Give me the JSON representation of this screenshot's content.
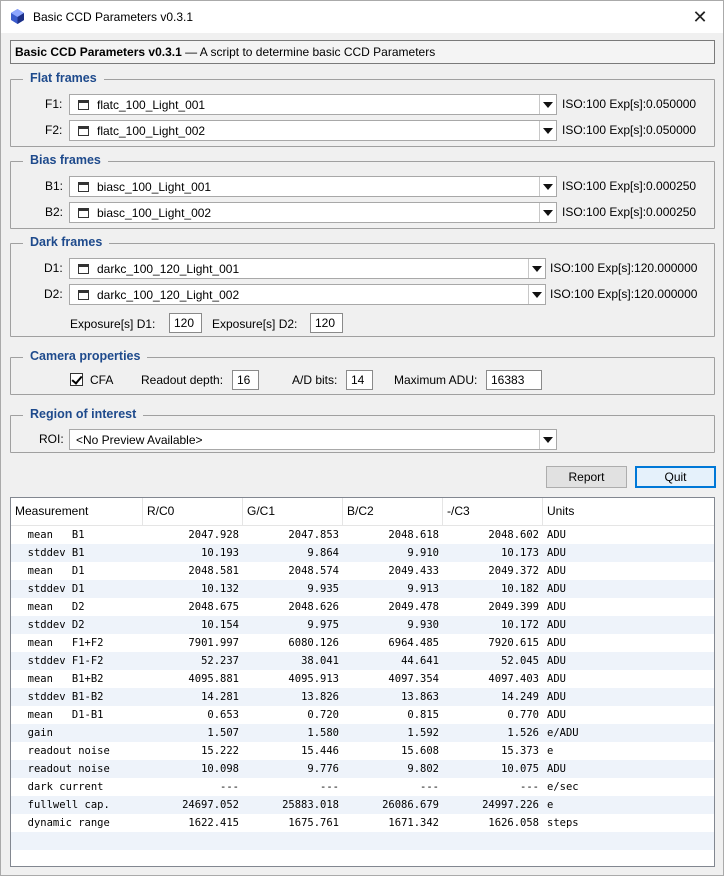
{
  "window": {
    "title": "Basic CCD Parameters v0.3.1",
    "close_glyph": "✕"
  },
  "header": {
    "name": "Basic CCD Parameters v0.3.1",
    "separator": " — ",
    "description": "A script to determine basic CCD Parameters"
  },
  "flat": {
    "legend": "Flat frames",
    "rows": [
      {
        "label": "F1:",
        "value": "flatc_100_Light_001",
        "info": "ISO:100 Exp[s]:0.050000"
      },
      {
        "label": "F2:",
        "value": "flatc_100_Light_002",
        "info": "ISO:100 Exp[s]:0.050000"
      }
    ]
  },
  "bias": {
    "legend": "Bias frames",
    "rows": [
      {
        "label": "B1:",
        "value": "biasc_100_Light_001",
        "info": "ISO:100 Exp[s]:0.000250"
      },
      {
        "label": "B2:",
        "value": "biasc_100_Light_002",
        "info": "ISO:100 Exp[s]:0.000250"
      }
    ]
  },
  "dark": {
    "legend": "Dark frames",
    "rows": [
      {
        "label": "D1:",
        "value": "darkc_100_120_Light_001",
        "info": "ISO:100 Exp[s]:120.000000"
      },
      {
        "label": "D2:",
        "value": "darkc_100_120_Light_002",
        "info": "ISO:100 Exp[s]:120.000000"
      }
    ],
    "exp_d1_label": "Exposure[s] D1:",
    "exp_d1_value": "120",
    "exp_d2_label": "Exposure[s] D2:",
    "exp_d2_value": "120"
  },
  "camera": {
    "legend": "Camera properties",
    "cfa_label": "CFA",
    "cfa_checked": true,
    "readout_label": "Readout depth:",
    "readout_value": "16",
    "adbits_label": "A/D bits:",
    "adbits_value": "14",
    "maxadu_label": "Maximum ADU:",
    "maxadu_value": "16383"
  },
  "roi": {
    "legend": "Region of interest",
    "label": "ROI:",
    "value": "<No Preview Available>"
  },
  "buttons": {
    "report": "Report",
    "quit": "Quit"
  },
  "table": {
    "headers": [
      "Measurement",
      "R/C0",
      "G/C1",
      "B/C2",
      "-/C3",
      "Units"
    ],
    "rows": [
      [
        "  mean   B1",
        "2047.928",
        "2047.853",
        "2048.618",
        "2048.602",
        "ADU"
      ],
      [
        "  stddev B1",
        "10.193",
        "9.864",
        "9.910",
        "10.173",
        "ADU"
      ],
      [
        "  mean   D1",
        "2048.581",
        "2048.574",
        "2049.433",
        "2049.372",
        "ADU"
      ],
      [
        "  stddev D1",
        "10.132",
        "9.935",
        "9.913",
        "10.182",
        "ADU"
      ],
      [
        "  mean   D2",
        "2048.675",
        "2048.626",
        "2049.478",
        "2049.399",
        "ADU"
      ],
      [
        "  stddev D2",
        "10.154",
        "9.975",
        "9.930",
        "10.172",
        "ADU"
      ],
      [
        "  mean   F1+F2",
        "7901.997",
        "6080.126",
        "6964.485",
        "7920.615",
        "ADU"
      ],
      [
        "  stddev F1-F2",
        "52.237",
        "38.041",
        "44.641",
        "52.045",
        "ADU"
      ],
      [
        "  mean   B1+B2",
        "4095.881",
        "4095.913",
        "4097.354",
        "4097.403",
        "ADU"
      ],
      [
        "  stddev B1-B2",
        "14.281",
        "13.826",
        "13.863",
        "14.249",
        "ADU"
      ],
      [
        "  mean   D1-B1",
        "0.653",
        "0.720",
        "0.815",
        "0.770",
        "ADU"
      ],
      [
        "  gain",
        "1.507",
        "1.580",
        "1.592",
        "1.526",
        "e/ADU"
      ],
      [
        "  readout noise",
        "15.222",
        "15.446",
        "15.608",
        "15.373",
        "e"
      ],
      [
        "  readout noise",
        "10.098",
        "9.776",
        "9.802",
        "10.075",
        "ADU"
      ],
      [
        "  dark current",
        "---",
        "---",
        "---",
        "---",
        "e/sec"
      ],
      [
        "  fullwell cap.",
        "24697.052",
        "25883.018",
        "26086.679",
        "24997.226",
        "e"
      ],
      [
        "  dynamic range",
        "1622.415",
        "1675.761",
        "1671.342",
        "1626.058",
        "steps"
      ]
    ]
  },
  "colors": {
    "legend": "#1e4a8c",
    "row_alt": "#eef3fa",
    "default_button_border": "#0078d7"
  }
}
